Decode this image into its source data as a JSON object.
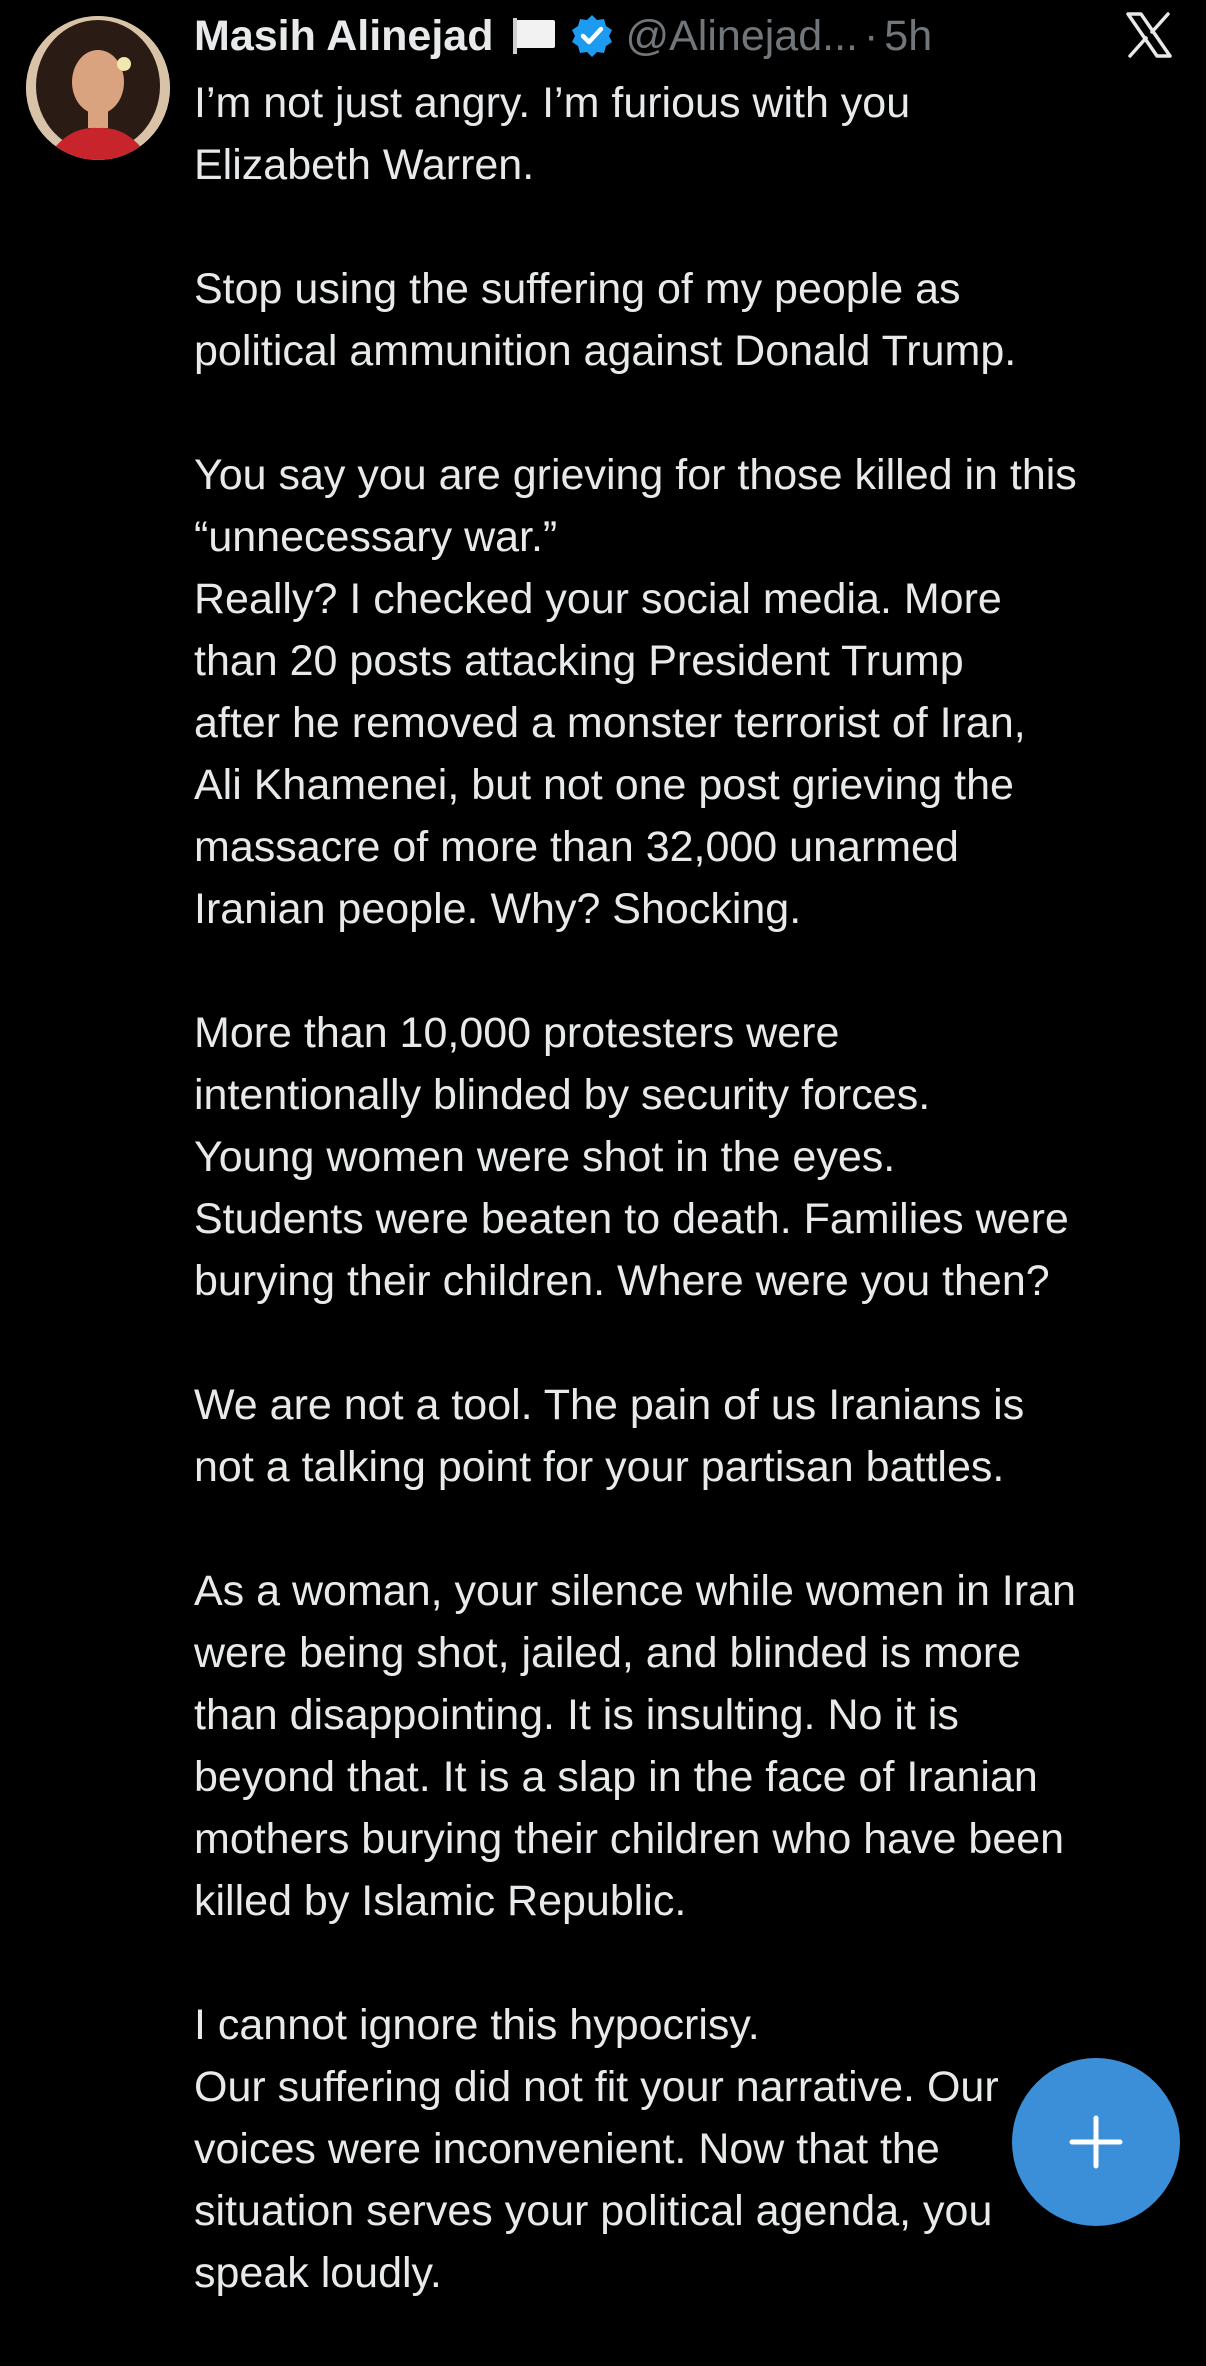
{
  "author": {
    "name": "Masih Alinejad",
    "handle": "@Alinejad...",
    "separator": "·",
    "time": "5h"
  },
  "icons": {
    "flag": "white-flag-icon",
    "verified": "verified-badge-icon",
    "brand": "x-logo-icon",
    "compose": "plus-icon"
  },
  "colors": {
    "background": "#000000",
    "text": "#e7e9ea",
    "muted": "#71767b",
    "verified": "#1d9bf0",
    "fab": "#3b8fd9"
  },
  "post": {
    "paragraphs": [
      [
        "I’m not just angry. I’m furious with you",
        "Elizabeth Warren."
      ],
      [
        "Stop using the suffering of my people as",
        "political ammunition  against Donald Trump."
      ],
      [
        "You say you are grieving for those killed in this",
        "“unnecessary war.”",
        "Really?  I checked your social media. More",
        "than 20 posts attacking President Trump",
        "after he removed a monster terrorist of Iran,",
        "Ali Khamenei, but not one post grieving the",
        "massacre of more than 32,000 unarmed",
        "Iranian people. Why? Shocking."
      ],
      [
        "More than 10,000 protesters were",
        "intentionally blinded by security forces.",
        "Young women were shot in the eyes.",
        "Students were beaten to death. Families were",
        "burying their children. Where were you then?"
      ],
      [
        "We are not a tool. The pain of us Iranians is",
        "not a talking point for your partisan battles."
      ],
      [
        "As a woman, your silence while women in Iran",
        "were being shot, jailed, and blinded is more",
        "than disappointing. It is insulting. No it is",
        "beyond that. It is a slap in the face of Iranian",
        "mothers burying their children who have been",
        "killed by Islamic Republic."
      ],
      [
        "I cannot ignore this hypocrisy.",
        "Our suffering did not fit your narrative. Our",
        "voices were inconvenient. Now that the",
        "situation serves your political agenda, you",
        "speak loudly."
      ]
    ]
  }
}
